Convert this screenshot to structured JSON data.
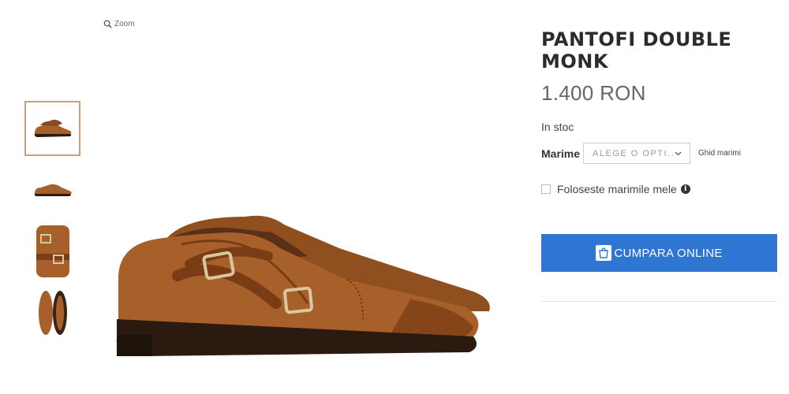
{
  "gallery": {
    "zoom_label": "Zoom",
    "zoom_icon": "magnifier-icon",
    "thumbnails": [
      {
        "icon": "shoe-three-quarter-thumbnail",
        "active": true
      },
      {
        "icon": "shoe-side-thumbnail",
        "active": false
      },
      {
        "icon": "shoe-buckle-closeup-thumbnail",
        "active": false
      },
      {
        "icon": "shoe-sole-thumbnail",
        "active": false
      }
    ]
  },
  "product": {
    "title": "PANTOFI DOUBLE MONK",
    "price": "1.400 RON",
    "stock": "In stoc",
    "size_label": "Marime",
    "size_select_value": "ALEGE O OPTI...",
    "size_guide": "Ghid marimi",
    "my_sizes_label": "Foloseste marimile mele",
    "buy_label": "CUMPARA ONLINE",
    "buy_icon": "shopping-bag-icon",
    "info_icon": "info-icon"
  },
  "colors": {
    "accent_blue": "#2f76d2",
    "leather_brown": "#a8602a",
    "thumb_border": "#c9a27a"
  }
}
